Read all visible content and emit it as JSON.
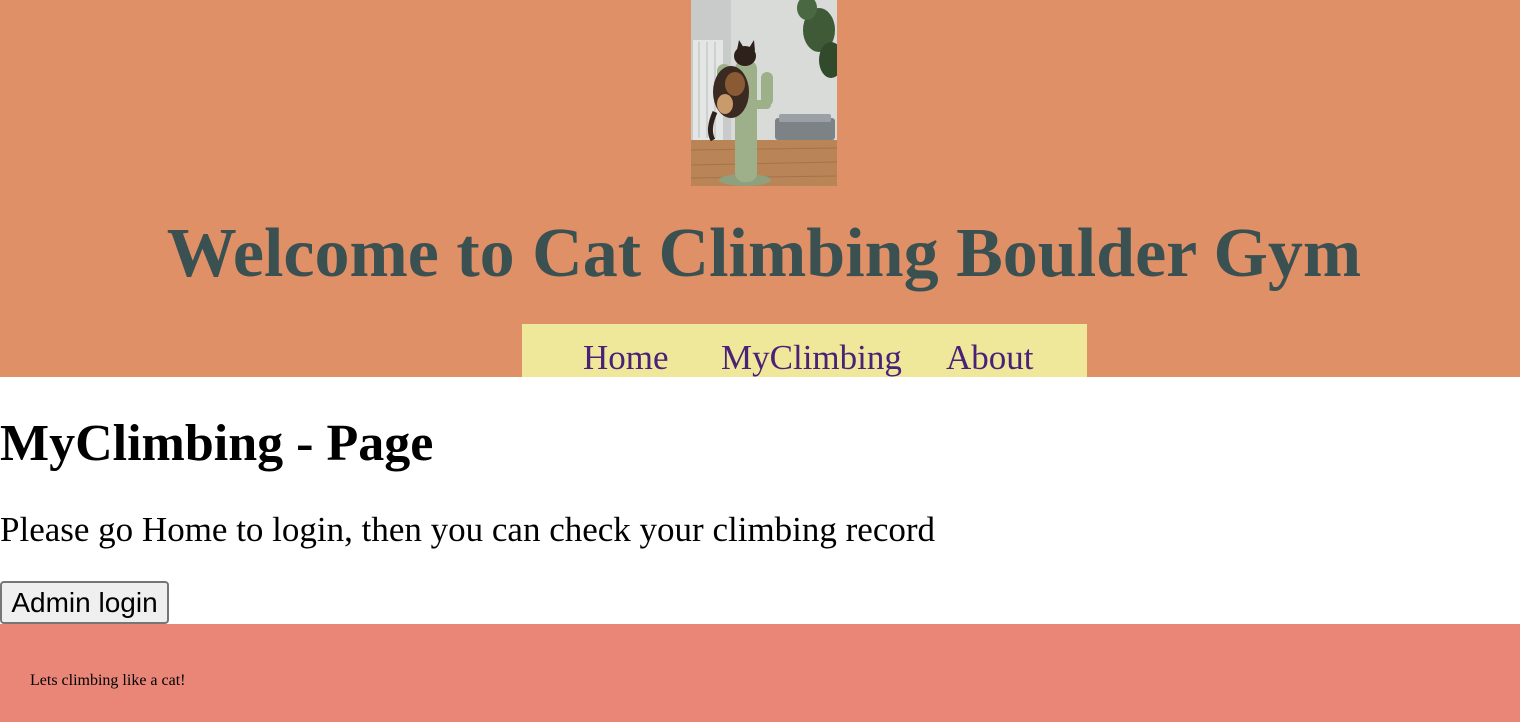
{
  "header": {
    "title": "Welcome to Cat Climbing Boulder Gym",
    "background_color": "#df9067",
    "title_color": "#3b5151",
    "image": "cat-on-scratching-post-photo"
  },
  "nav": {
    "background_color": "#efe89b",
    "link_color": "#4b2178",
    "items": [
      {
        "label": "Home"
      },
      {
        "label": "MyClimbing"
      },
      {
        "label": "About"
      }
    ]
  },
  "main": {
    "heading": "MyClimbing - Page",
    "message": "Please go Home to login, then you can check your climbing record",
    "admin_button_label": "Admin login"
  },
  "footer": {
    "text": "Lets climbing like a cat!",
    "background_color": "#e98677"
  }
}
